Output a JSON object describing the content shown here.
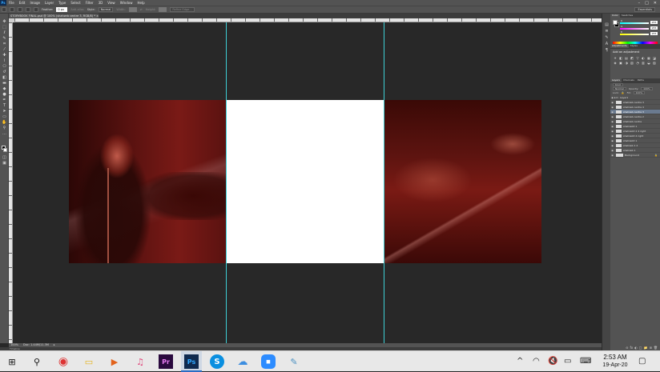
{
  "menubar": {
    "app_icon": "Ps",
    "items": [
      "File",
      "Edit",
      "Image",
      "Layer",
      "Type",
      "Select",
      "Filter",
      "3D",
      "View",
      "Window",
      "Help"
    ],
    "window_controls": [
      "–",
      "□",
      "✕"
    ]
  },
  "options": {
    "feather_label": "Feather:",
    "feather_value": "0 px",
    "antialias": "Anti-alias",
    "style_label": "Style:",
    "style_value": "Normal",
    "width_label": "Width:",
    "height_label": "Height:",
    "refine_edge": "Refine Edge...",
    "workspace": "Essentials"
  },
  "document": {
    "tab_title": "STORYBOOK FINAL.psd @ 100% (shahzeb centre 3, RGB/8) *",
    "close_glyph": "×"
  },
  "status": {
    "zoom": "100%",
    "doc_info": "Doc: 1.44M/11.3M"
  },
  "timeline": {
    "label": "Timeline"
  },
  "panels": {
    "color_tabs": [
      "Color",
      "Swatches"
    ],
    "color_values": {
      "r": "255",
      "g": "255",
      "b": "255"
    },
    "slider_labels": [
      "R",
      "G",
      "B"
    ],
    "adjust_tabs": [
      "Adjustments",
      "Styles"
    ],
    "adjust_title": "Add an adjustment",
    "adjust_icons": [
      "☀",
      "◧",
      "▤",
      "◩",
      "▽",
      "◐",
      "▦",
      "◪",
      "◈",
      "▣",
      "◑",
      "▧",
      "◔",
      "▥",
      "◒",
      "▨"
    ],
    "layers_tabs": [
      "Layers",
      "Channels",
      "Paths"
    ],
    "kind_label": "Kind",
    "blend_mode": "Normal",
    "opacity_label": "Opacity:",
    "opacity_value": "100%",
    "lock_label": "Lock:",
    "fill_label": "Fill:",
    "fill_value": "100%",
    "layers": [
      {
        "name": "Layer1",
        "visible": true,
        "selected": false,
        "folder": true
      },
      {
        "name": "shahzeb centre 3",
        "visible": true,
        "selected": false,
        "folder": false
      },
      {
        "name": "shahzeb centre 4",
        "visible": true,
        "selected": false,
        "folder": false
      },
      {
        "name": "shahzeb centre 3",
        "visible": true,
        "selected": true,
        "folder": false
      },
      {
        "name": "shahzeb centre 2",
        "visible": true,
        "selected": false,
        "folder": false
      },
      {
        "name": "shahzeb centre",
        "visible": true,
        "selected": false,
        "folder": false
      },
      {
        "name": "shahzeb3 1",
        "visible": true,
        "selected": false,
        "folder": false
      },
      {
        "name": "shahzeb3 2 4 right",
        "visible": true,
        "selected": false,
        "folder": false
      },
      {
        "name": "shahzeb3 4 right",
        "visible": true,
        "selected": false,
        "folder": false
      },
      {
        "name": "shahzeb3 1",
        "visible": true,
        "selected": false,
        "folder": false
      },
      {
        "name": "shahzeb 1 2",
        "visible": true,
        "selected": false,
        "folder": false
      },
      {
        "name": "shahzeb 1",
        "visible": true,
        "selected": false,
        "folder": false
      },
      {
        "name": "Background",
        "visible": true,
        "selected": false,
        "folder": false,
        "locked": true
      }
    ],
    "footer_icons": [
      "⊝",
      "fx",
      "◐",
      "▢",
      "📁",
      "⊞",
      "🗑"
    ]
  },
  "taskbar": {
    "clock_time": "2:53 AM",
    "clock_date": "19-Apr-20",
    "apps": [
      {
        "name": "windows-start",
        "glyph": "⊞"
      },
      {
        "name": "search",
        "glyph": "⚲"
      },
      {
        "name": "chrome",
        "glyph": "◉"
      },
      {
        "name": "file-explorer",
        "glyph": "▭"
      },
      {
        "name": "media-player",
        "glyph": "▶"
      },
      {
        "name": "itunes",
        "glyph": "♫"
      },
      {
        "name": "premiere",
        "glyph": "Pr"
      },
      {
        "name": "photoshop",
        "glyph": "Ps"
      },
      {
        "name": "skype",
        "glyph": "S"
      },
      {
        "name": "onedrive",
        "glyph": "☁"
      },
      {
        "name": "zoom",
        "glyph": "◼"
      },
      {
        "name": "paint",
        "glyph": "✎"
      }
    ],
    "tray": [
      "^",
      "◠",
      "🔇",
      "▭",
      "⌨",
      "▢"
    ]
  },
  "colors": {
    "guide": "#3ecfd6",
    "ps_blue": "#31a8ff",
    "premiere_purple": "#2a0a3e"
  }
}
